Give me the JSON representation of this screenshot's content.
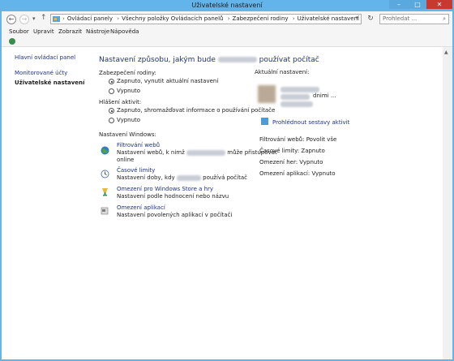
{
  "window": {
    "title": "Uživatelské nastavení",
    "min_glyph": "–",
    "max_glyph": "□",
    "close_glyph": "✕"
  },
  "nav": {
    "back_glyph": "←",
    "forward_glyph": "→",
    "up_glyph": "↑",
    "breadcrumbs": [
      "Ovládací panely",
      "Všechny položky Ovládacích panelů",
      "Zabezpečení rodiny",
      "Uživatelské nastavení"
    ],
    "separator": "›",
    "refresh_glyph": "↻",
    "search_placeholder": "Prohledat ..."
  },
  "menu": [
    "Soubor",
    "Upravit",
    "Zobrazit",
    "Nástroje",
    "Nápověda"
  ],
  "sidebar": {
    "items": [
      {
        "label": "Hlavní ovládací panel"
      },
      {
        "label": "Monitorované účty"
      },
      {
        "label": "Uživatelské nastavení"
      }
    ]
  },
  "main": {
    "heading_prefix": "Nastavení způsobu, jakým bude",
    "heading_suffix": "používat počítač",
    "family_safety": {
      "label": "Zabezpečení rodiny:",
      "options": [
        "Zapnuto, vynutit aktuální nastavení",
        "Vypnuto"
      ],
      "selected": 0
    },
    "activity_reporting": {
      "label": "Hlášení aktivit:",
      "options": [
        "Zapnuto, shromažďovat informace o používání počítače",
        "Vypnuto"
      ],
      "selected": 0
    },
    "windows_settings_label": "Nastavení Windows:",
    "settings": [
      {
        "title": "Filtrování webů",
        "desc_prefix": "Nastavení webů, k nimž",
        "desc_suffix": "může přistupovat",
        "desc_line2": "online",
        "icon": "globe-icon"
      },
      {
        "title": "Časové limity",
        "desc_prefix": "Nastavení doby, kdy",
        "desc_suffix": "používá počítač",
        "icon": "clock-icon"
      },
      {
        "title": "Omezení pro Windows Store a hry",
        "desc": "Nastavení podle hodnocení nebo názvu",
        "icon": "trophy-icon"
      },
      {
        "title": "Omezení aplikací",
        "desc": "Nastavení povolených aplikací v počítači",
        "icon": "app-lock-icon"
      }
    ]
  },
  "current": {
    "label": "Aktuální nastavení:",
    "user_suffix": "dnimi ...",
    "report_link": "Prohlédnout sestavy aktivit",
    "stats": [
      "Filtrování webů: Povolit vše",
      "Časové limity: Zapnuto",
      "Omezení her: Vypnuto",
      "Omezení aplikací: Vypnuto"
    ]
  }
}
